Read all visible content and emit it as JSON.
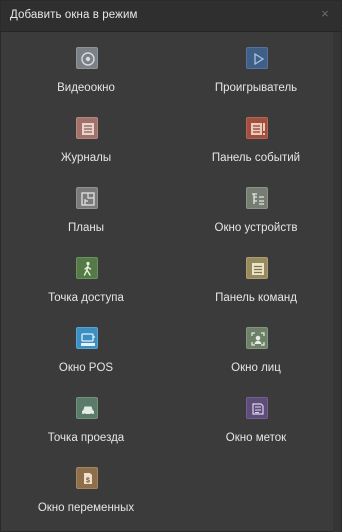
{
  "window": {
    "title": "Добавить окна в режим",
    "close_glyph": "×"
  },
  "items": [
    {
      "label": "Видеоокно",
      "icon": "video-window-icon",
      "color": "#7a8085"
    },
    {
      "label": "Проигрыватель",
      "icon": "player-icon",
      "color": "#3f5f86"
    },
    {
      "label": "Журналы",
      "icon": "journals-icon",
      "color": "#a0726a"
    },
    {
      "label": "Панель событий",
      "icon": "events-panel-icon",
      "color": "#a0503e"
    },
    {
      "label": "Планы",
      "icon": "plans-icon",
      "color": "#7a7a7a"
    },
    {
      "label": "Окно устройств",
      "icon": "devices-window-icon",
      "color": "#767d73"
    },
    {
      "label": "Точка доступа",
      "icon": "access-point-icon",
      "color": "#557a48"
    },
    {
      "label": "Панель команд",
      "icon": "commands-panel-icon",
      "color": "#968a5e"
    },
    {
      "label": "Окно POS",
      "icon": "pos-window-icon",
      "color": "#3d8fc0"
    },
    {
      "label": "Окно лиц",
      "icon": "faces-window-icon",
      "color": "#6d8068"
    },
    {
      "label": "Точка проезда",
      "icon": "vehicle-point-icon",
      "color": "#5b7a6a"
    },
    {
      "label": "Окно меток",
      "icon": "tags-window-icon",
      "color": "#5d4d79"
    },
    {
      "label": "Окно переменных",
      "icon": "variables-window-icon",
      "color": "#8f6e4b"
    }
  ]
}
